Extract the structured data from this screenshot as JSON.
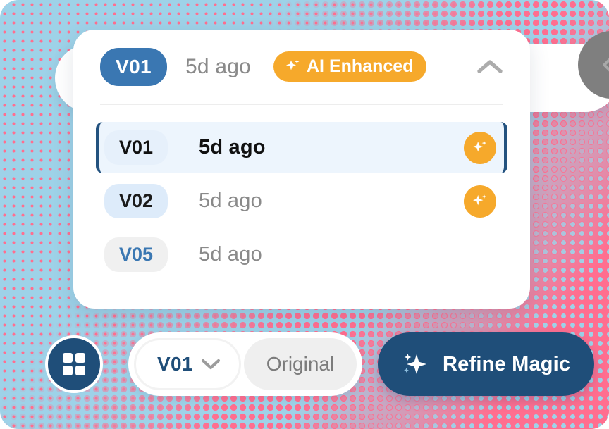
{
  "panel": {
    "header": {
      "version_label": "V01",
      "time_label": "5d ago",
      "ai_badge_label": "AI Enhanced",
      "ai_badge_icon": "sparkle-icon",
      "collapse_icon": "chevron-up-icon",
      "badge_color": "#3A77B2",
      "ai_badge_color": "#F6A92B"
    },
    "versions": [
      {
        "version": "V01",
        "time": "5d ago",
        "ai_enhanced": true,
        "selected": true
      },
      {
        "version": "V02",
        "time": "5d ago",
        "ai_enhanced": true,
        "selected": false
      },
      {
        "version": "V05",
        "time": "5d ago",
        "ai_enhanced": false,
        "selected": false
      }
    ]
  },
  "background_toolbar": {
    "avatar_icon": "chevron-left-icon",
    "avatar_color": "#7F7F7F"
  },
  "bottom_bar": {
    "grid_button_icon": "grid-2x2-icon",
    "grid_button_color": "#1F4E79",
    "version_select_value": "V01",
    "version_select_icon": "chevron-down-icon",
    "original_tab_label": "Original",
    "refine_button_label": "Refine Magic",
    "refine_button_icon": "sparkle-icon",
    "refine_button_color": "#1F4E79"
  },
  "theme": {
    "background_blue": "#9ED2E8",
    "background_pink": "#FF6E8F",
    "accent_orange": "#F6A92B",
    "accent_navy": "#1F4E79",
    "accent_blue": "#3A77B2"
  }
}
